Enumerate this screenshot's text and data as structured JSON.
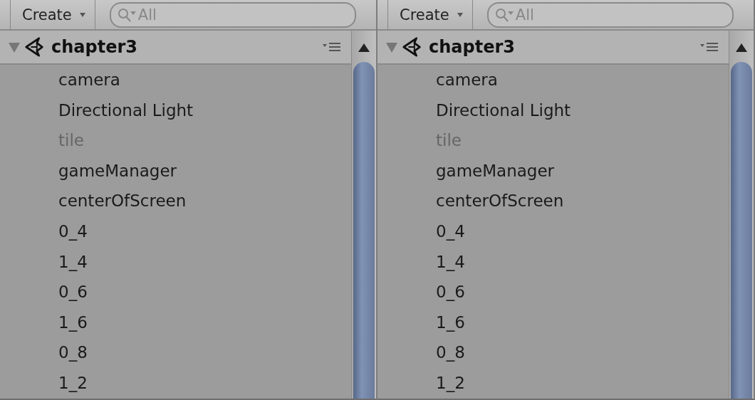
{
  "panels": [
    {
      "create_button": "Create",
      "search": {
        "value": "All"
      },
      "scene": {
        "name": "chapter3",
        "expanded": true,
        "children": [
          {
            "name": "camera",
            "active": true
          },
          {
            "name": "Directional Light",
            "active": true
          },
          {
            "name": "tile",
            "active": false
          },
          {
            "name": "gameManager",
            "active": true
          },
          {
            "name": "centerOfScreen",
            "active": true
          },
          {
            "name": "0_4",
            "active": true
          },
          {
            "name": "1_4",
            "active": true
          },
          {
            "name": "0_6",
            "active": true
          },
          {
            "name": "1_6",
            "active": true
          },
          {
            "name": "0_8",
            "active": true
          },
          {
            "name": "1_2",
            "active": true
          }
        ]
      }
    },
    {
      "create_button": "Create",
      "search": {
        "value": "All"
      },
      "scene": {
        "name": "chapter3",
        "expanded": true,
        "children": [
          {
            "name": "camera",
            "active": true
          },
          {
            "name": "Directional Light",
            "active": true
          },
          {
            "name": "tile",
            "active": false
          },
          {
            "name": "gameManager",
            "active": true
          },
          {
            "name": "centerOfScreen",
            "active": true
          },
          {
            "name": "0_4",
            "active": true
          },
          {
            "name": "1_4",
            "active": true
          },
          {
            "name": "0_6",
            "active": true
          },
          {
            "name": "1_6",
            "active": true
          },
          {
            "name": "0_8",
            "active": true
          },
          {
            "name": "1_2",
            "active": true
          }
        ]
      }
    }
  ]
}
